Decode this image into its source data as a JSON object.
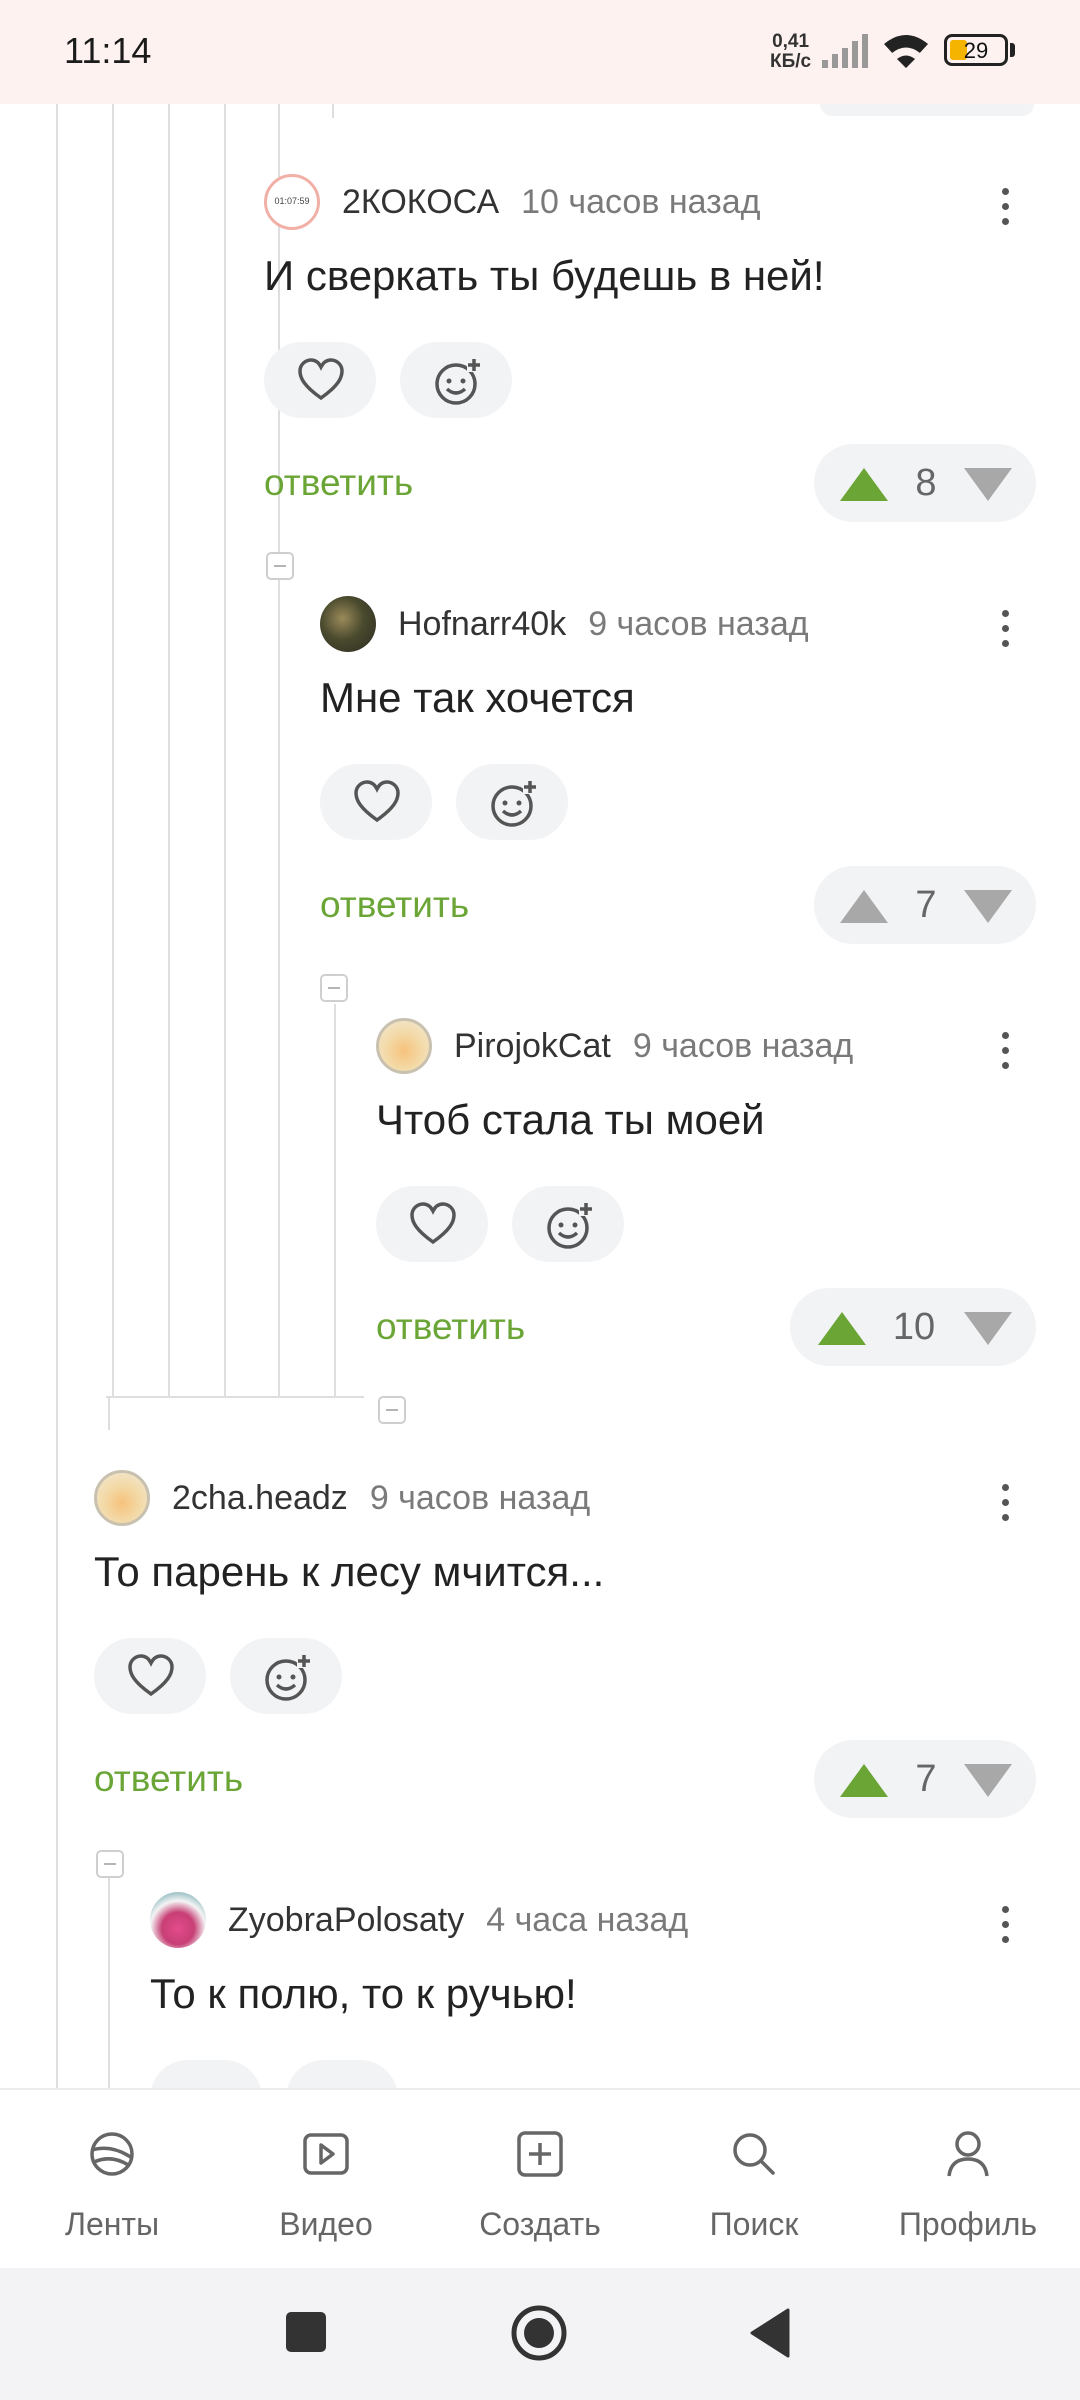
{
  "status_bar": {
    "time": "11:14",
    "speed_value": "0,41",
    "speed_unit": "КБ/с",
    "battery": "29",
    "icons": [
      "signal-icon",
      "wifi-icon",
      "battery-icon"
    ]
  },
  "comments": [
    {
      "author": "2КОКОСА",
      "time": "10 часов назад",
      "text": "И сверкать ты будешь в ней!",
      "votes": "8",
      "avatar_text": "01:07:59",
      "avatar": "clock-avatar"
    },
    {
      "author": "Hofnarr40k",
      "time": "9 часов назад",
      "text": "Мне так хочется",
      "votes": "7",
      "avatar": "photo-avatar"
    },
    {
      "author": "PirojokCat",
      "time": "9 часов назад",
      "text": "Чтоб стала ты моей",
      "votes": "10",
      "avatar": "cat-avatar"
    },
    {
      "author": "2cha.headz",
      "time": "9 часов назад",
      "text": "То парень к лесу мчится...",
      "votes": "7",
      "avatar": "cat-avatar"
    },
    {
      "author": "ZyobraPolosaty",
      "time": "4 часа назад",
      "text": "То к полю, то к ручью!",
      "avatar": "zebra-avatar"
    }
  ],
  "reply_label": "ответить",
  "nav": [
    {
      "label": "Ленты",
      "icon": "feeds-icon"
    },
    {
      "label": "Видео",
      "icon": "video-icon"
    },
    {
      "label": "Создать",
      "icon": "create-icon"
    },
    {
      "label": "Поиск",
      "icon": "search-icon"
    },
    {
      "label": "Профиль",
      "icon": "profile-icon"
    }
  ],
  "colors": {
    "accent_green": "#6aa536",
    "vote_grey": "#a8a8a8",
    "status_bar_bg": "#fdf2ef"
  }
}
